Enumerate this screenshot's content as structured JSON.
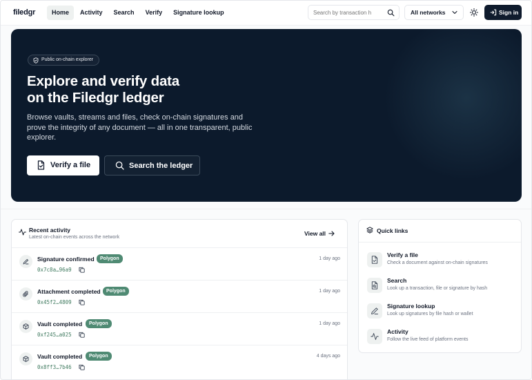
{
  "header": {
    "logo": "filedgr",
    "nav": [
      {
        "label": "Home",
        "active": true
      },
      {
        "label": "Activity"
      },
      {
        "label": "Search"
      },
      {
        "label": "Verify"
      },
      {
        "label": "Signature lookup"
      }
    ],
    "search_placeholder": "Search by transaction h",
    "network": "All networks",
    "signin_label": "Sign in"
  },
  "hero": {
    "badge": "Public on-chain explorer",
    "title_line1": "Explore and verify data",
    "title_line2": "on the Filedgr ledger",
    "description": "Browse vaults, streams and files, check on-chain signatures and prove the integrity of any document — all in one transparent, public explorer.",
    "verify_label": "Verify a file",
    "search_label": "Search the ledger"
  },
  "activity": {
    "title": "Recent activity",
    "subtitle": "Latest on-chain events across the network",
    "view_all": "View all",
    "items": [
      {
        "title": "Signature confirmed",
        "network": "Polygon",
        "hash": "0x7c8a…96a9",
        "time": "1 day ago",
        "icon": "pen-icon"
      },
      {
        "title": "Attachment completed",
        "network": "Polygon",
        "hash": "0x45f2…4809",
        "time": "1 day ago",
        "icon": "paperclip-icon"
      },
      {
        "title": "Vault completed",
        "network": "Polygon",
        "hash": "0xf245…a025",
        "time": "1 day ago",
        "icon": "cube-icon"
      },
      {
        "title": "Vault completed",
        "network": "Polygon",
        "hash": "0x8ff3…7b46",
        "time": "4 days ago",
        "icon": "cube-icon"
      }
    ]
  },
  "quick_links": {
    "title": "Quick links",
    "items": [
      {
        "title": "Verify a file",
        "desc": "Check a document against on-chain signatures",
        "icon": "file-check-icon"
      },
      {
        "title": "Search",
        "desc": "Look up a transaction, file or signature by hash",
        "icon": "file-search-icon"
      },
      {
        "title": "Signature lookup",
        "desc": "Look up signatures by file hash or wallet",
        "icon": "pen-icon"
      },
      {
        "title": "Activity",
        "desc": "Follow the live feed of platform events",
        "icon": "activity-icon"
      }
    ]
  },
  "colors": {
    "hero_bg": "#0c1a2c",
    "badge_bg": "#4f8a73",
    "hash_text": "#3f7a5f",
    "primary_button": "#0f1b2d"
  }
}
